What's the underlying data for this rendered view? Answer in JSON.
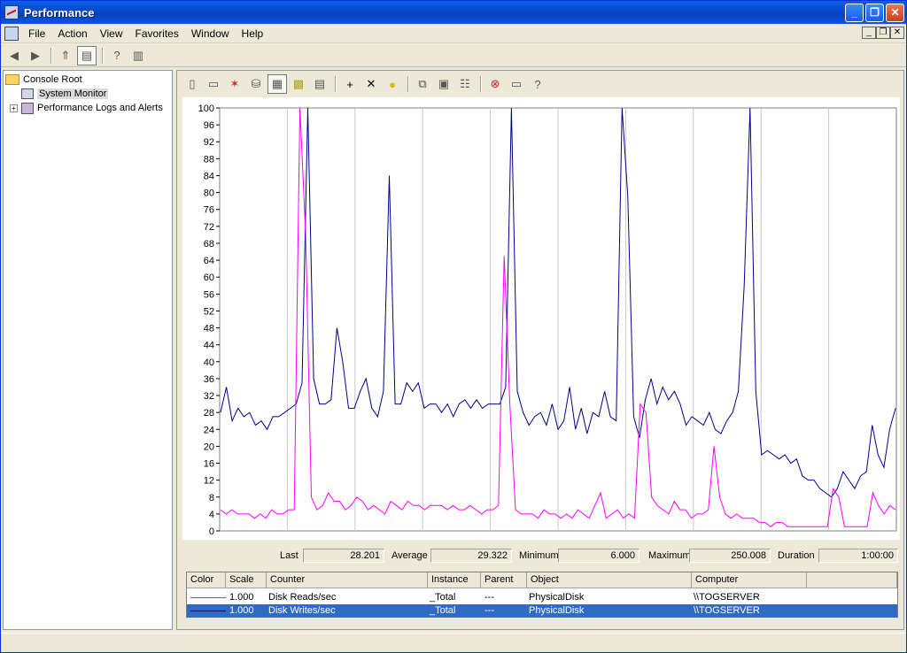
{
  "window": {
    "title": "Performance"
  },
  "menu": [
    "File",
    "Action",
    "View",
    "Favorites",
    "Window",
    "Help"
  ],
  "tree": {
    "root": "Console Root",
    "items": [
      {
        "label": "System Monitor",
        "selected": true
      },
      {
        "label": "Performance Logs and Alerts",
        "expandable": true
      }
    ]
  },
  "stats": {
    "last_label": "Last",
    "last": "28.201",
    "average_label": "Average",
    "average": "29.322",
    "minimum_label": "Minimum",
    "minimum": "6.000",
    "maximum_label": "Maximum",
    "maximum": "250.008",
    "duration_label": "Duration",
    "duration": "1:00:00"
  },
  "legend": {
    "headers": [
      "Color",
      "Scale",
      "Counter",
      "Instance",
      "Parent",
      "Object",
      "Computer"
    ],
    "rows": [
      {
        "color": "#ff00ff",
        "scale": "1.000",
        "counter": "Disk Reads/sec",
        "instance": "_Total",
        "parent": "---",
        "object": "PhysicalDisk",
        "computer": "\\\\TOGSERVER",
        "selected": false
      },
      {
        "color": "#00008b",
        "scale": "1.000",
        "counter": "Disk Writes/sec",
        "instance": "_Total",
        "parent": "---",
        "object": "PhysicalDisk",
        "computer": "\\\\TOGSERVER",
        "selected": true
      }
    ]
  },
  "chart_data": {
    "type": "line",
    "ylim": [
      0,
      100
    ],
    "yticks": [
      "0",
      "4",
      "8",
      "12",
      "16",
      "20",
      "24",
      "28",
      "32",
      "36",
      "40",
      "44",
      "48",
      "52",
      "56",
      "60",
      "64",
      "68",
      "72",
      "76",
      "80",
      "84",
      "88",
      "92",
      "96",
      "100"
    ],
    "grid": "vertical",
    "series": [
      {
        "name": "Disk Writes/sec",
        "color": "#00008b",
        "values": [
          28,
          34,
          26,
          29,
          27,
          28,
          25,
          26,
          24,
          27,
          27,
          28,
          29,
          30,
          35,
          100,
          36,
          30,
          30,
          31,
          48,
          40,
          29,
          29,
          33,
          36,
          29,
          27,
          33,
          84,
          30,
          30,
          35,
          33,
          35,
          29,
          30,
          30,
          28,
          30,
          27,
          30,
          31,
          29,
          31,
          29,
          30,
          30,
          30,
          34,
          100,
          33,
          28,
          25,
          27,
          28,
          25,
          30,
          24,
          26,
          34,
          24,
          29,
          23,
          28,
          27,
          33,
          27,
          26,
          100,
          79,
          27,
          22,
          31,
          36,
          30,
          34,
          31,
          33,
          30,
          25,
          27,
          26,
          25,
          28,
          24,
          23,
          26,
          28,
          33,
          58,
          100,
          33,
          18,
          19,
          18,
          17,
          18,
          16,
          17,
          13,
          12,
          12,
          10,
          9,
          8,
          10,
          14,
          12,
          10,
          13,
          14,
          25,
          18,
          15,
          24,
          29
        ]
      },
      {
        "name": "Disk Reads/sec",
        "color": "#ff00ff",
        "values": [
          5,
          4,
          5,
          4,
          4,
          4,
          3,
          4,
          3,
          5,
          4,
          4,
          5,
          5,
          100,
          70,
          8,
          5,
          6,
          9,
          7,
          7,
          5,
          6,
          8,
          7,
          5,
          6,
          5,
          4,
          7,
          6,
          5,
          7,
          6,
          6,
          5,
          6,
          6,
          6,
          5,
          6,
          5,
          5,
          6,
          5,
          4,
          5,
          5,
          6,
          65,
          30,
          5,
          4,
          4,
          4,
          3,
          5,
          4,
          4,
          3,
          4,
          3,
          5,
          4,
          3,
          6,
          9,
          3,
          4,
          5,
          3,
          4,
          3,
          30,
          28,
          8,
          6,
          5,
          4,
          7,
          5,
          5,
          3,
          4,
          4,
          5,
          20,
          8,
          4,
          3,
          4,
          3,
          3,
          3,
          2,
          2,
          1,
          2,
          2,
          1,
          1,
          1,
          1,
          1,
          1,
          1,
          1,
          10,
          8,
          1,
          1,
          1,
          1,
          1,
          9,
          6,
          4,
          6,
          5
        ]
      }
    ]
  }
}
